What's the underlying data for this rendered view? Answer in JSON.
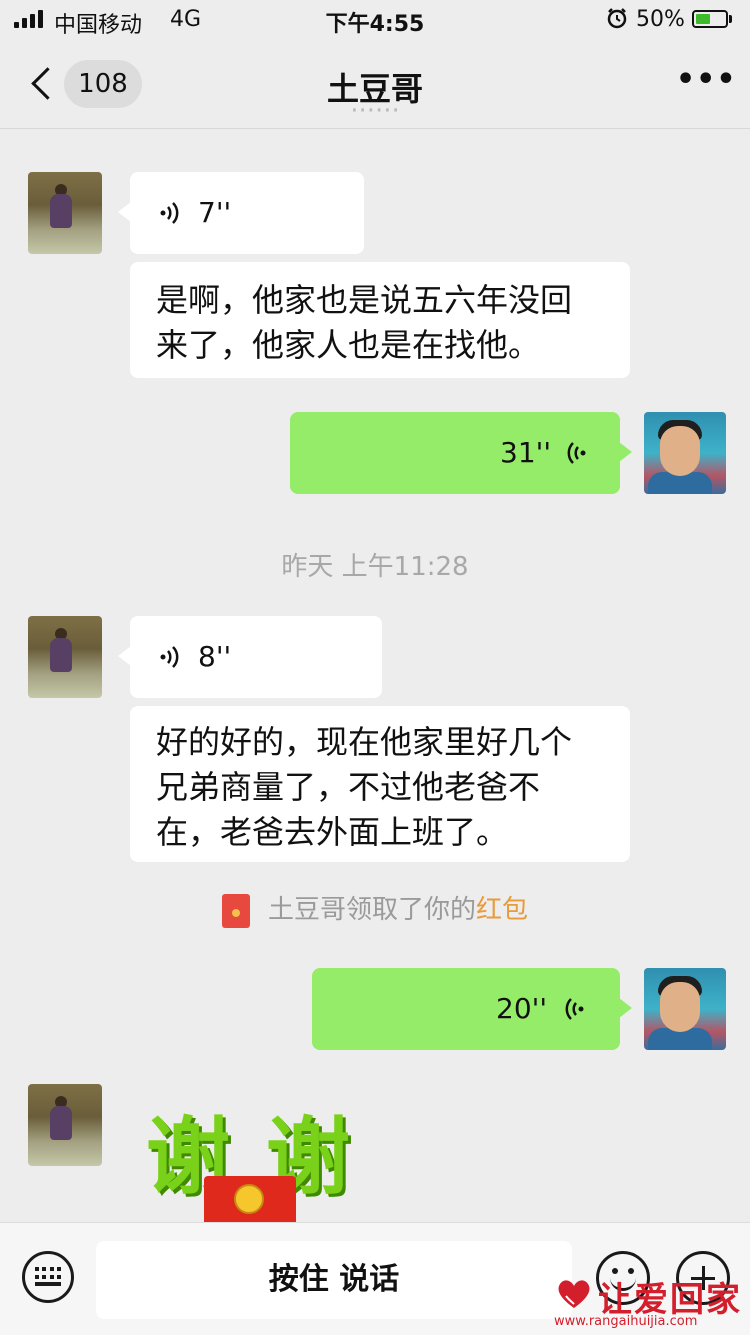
{
  "status_bar": {
    "carrier": "中国移动",
    "network": "4G",
    "time": "下午4:55",
    "battery": "50%",
    "battery_level": 0.5,
    "icons": [
      "signal-icon",
      "alarm-icon",
      "battery-charging-icon"
    ]
  },
  "nav": {
    "badge": "108",
    "title": "土豆哥",
    "more": "•••",
    "icons": [
      "back-chevron-icon",
      "more-icon"
    ]
  },
  "messages": {
    "m1_duration": "7''",
    "m2_text_line1": "是啊，他家也是说五六年没回",
    "m2_text_line2": "来了，他家人也是在找他。",
    "m3_duration": "31''",
    "timestamp": "昨天 上午11:28",
    "m4_duration": "8''",
    "m5_text_line1": "好的好的，现在他家里好几个",
    "m5_text_line2": "兄弟商量了，不过他老爸不",
    "m5_text_line3": "在，老爸去外面上班了。",
    "system_prefix": "土豆哥领取了你的",
    "system_link": "红包",
    "m6_duration": "20''",
    "sticker_char1": "谢",
    "sticker_char2": "谢"
  },
  "input_bar": {
    "hold_to_talk": "按住 说话",
    "icons": [
      "keyboard-icon",
      "emoji-icon",
      "plus-icon"
    ]
  },
  "watermark": {
    "brand": "让爱回家",
    "url": "www.rangaihuijia.com"
  },
  "colors": {
    "background": "#ededed",
    "incoming_bubble": "#ffffff",
    "outgoing_bubble": "#95ec69",
    "link": "#e79b3b",
    "watermark": "#d31e2c"
  }
}
